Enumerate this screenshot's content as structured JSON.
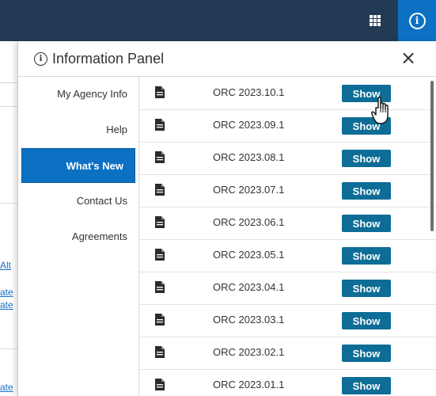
{
  "topbar": {
    "apps_icon": "grid-icon",
    "info_icon": "info-icon",
    "info_glyph": "i"
  },
  "background": {
    "link_fragments": [
      "Alt",
      "ate",
      "ate",
      "ate"
    ]
  },
  "panel": {
    "title_glyph": "i",
    "title": "Information Panel",
    "close_label": "×"
  },
  "nav": {
    "items": [
      {
        "label": "My Agency Info",
        "active": false
      },
      {
        "label": "Help",
        "active": false
      },
      {
        "label": "What's New",
        "active": true
      },
      {
        "label": "Contact Us",
        "active": false
      },
      {
        "label": "Agreements",
        "active": false
      }
    ]
  },
  "releases": [
    {
      "name": "ORC 2023.10.1",
      "button": "Show"
    },
    {
      "name": "ORC 2023.09.1",
      "button": "Show"
    },
    {
      "name": "ORC 2023.08.1",
      "button": "Show"
    },
    {
      "name": "ORC 2023.07.1",
      "button": "Show"
    },
    {
      "name": "ORC 2023.06.1",
      "button": "Show"
    },
    {
      "name": "ORC 2023.05.1",
      "button": "Show"
    },
    {
      "name": "ORC 2023.04.1",
      "button": "Show"
    },
    {
      "name": "ORC 2023.03.1",
      "button": "Show"
    },
    {
      "name": "ORC 2023.02.1",
      "button": "Show"
    },
    {
      "name": "ORC 2023.01.1",
      "button": "Show"
    }
  ],
  "colors": {
    "topbar": "#223a54",
    "accent": "#0c71c3",
    "show_button": "#0d6d96"
  }
}
